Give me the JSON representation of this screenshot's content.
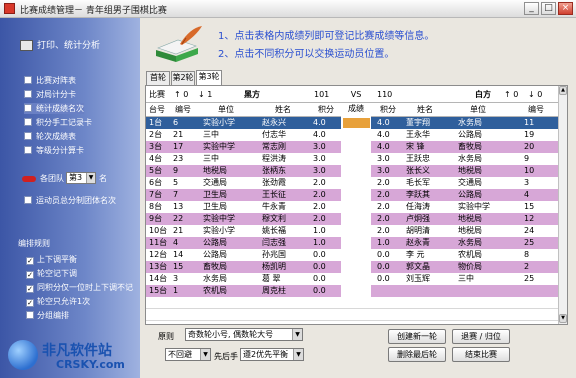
{
  "window": {
    "title": "比赛成绩管理－  青年组男子围棋比赛",
    "min": "_",
    "max": "□",
    "close": "×"
  },
  "sidebar": {
    "section_title": "打印、统计分析",
    "items": [
      {
        "label": "比赛对阵表"
      },
      {
        "label": "对局计分卡"
      },
      {
        "label": "统计成绩名次"
      },
      {
        "label": "积分手工记录卡"
      },
      {
        "label": "轮次成绩表"
      },
      {
        "label": "等级分计算卡"
      }
    ],
    "team_label": "各团队",
    "team_value": "第3",
    "team_suffix": "名",
    "unit_ranking": "运动员总分制团体名次",
    "rules_title": "编排规则",
    "rules": [
      {
        "label": "上下调平衡",
        "checked": "✓"
      },
      {
        "label": "轮空记下调",
        "checked": "✓"
      },
      {
        "label": "同积分仅一位时上下调不记",
        "checked": "✓"
      },
      {
        "label": "轮空只允许1次",
        "checked": "✓"
      },
      {
        "label": "分组编排",
        "checked": ""
      }
    ]
  },
  "hints": [
    "1、点击表格内成绩列即可登记比赛成绩等信息。",
    "2、点击不同积分可以交换运动员位置。"
  ],
  "tabs": [
    "首轮",
    "第2轮",
    "第3轮"
  ],
  "table": {
    "black_label": "比赛",
    "black_up": "↑ 0",
    "black_down": "↓ 1",
    "black_side": "黑方",
    "black_count": "101",
    "vs": "VS",
    "result_label": "成绩",
    "white_count": "110",
    "white_side": "白方",
    "white_up": "↑ 0",
    "white_down": "↓ 0",
    "cols_left": [
      "台号",
      "编号",
      "单位",
      "姓名",
      "积分"
    ],
    "cols_right": [
      "积分",
      "姓名",
      "单位",
      "编号"
    ],
    "rows": [
      {
        "board": "1台",
        "bno": "6",
        "bunit": "实验小学",
        "bname": "赵永兴",
        "bscore": "4.0",
        "wscore": "4.0",
        "wname": "董宇翔",
        "wunit": "水务局",
        "wno": "11",
        "style": "sel"
      },
      {
        "board": "2台",
        "bno": "21",
        "bunit": "三中",
        "bname": "付志华",
        "bscore": "4.0",
        "wscore": "4.0",
        "wname": "王永华",
        "wunit": "公路局",
        "wno": "19",
        "style": "white"
      },
      {
        "board": "3台",
        "bno": "17",
        "bunit": "实验中学",
        "bname": "常志刚",
        "bscore": "3.0",
        "wscore": "4.0",
        "wname": "宋 锋",
        "wunit": "畜牧局",
        "wno": "20",
        "style": "pink"
      },
      {
        "board": "4台",
        "bno": "23",
        "bunit": "三中",
        "bname": "程洪涛",
        "bscore": "3.0",
        "wscore": "3.0",
        "wname": "王跃忠",
        "wunit": "水务局",
        "wno": "9",
        "style": "white"
      },
      {
        "board": "5台",
        "bno": "9",
        "bunit": "地税局",
        "bname": "张柄东",
        "bscore": "3.0",
        "wscore": "3.0",
        "wname": "张长义",
        "wunit": "地税局",
        "wno": "10",
        "style": "pink"
      },
      {
        "board": "6台",
        "bno": "5",
        "bunit": "交通局",
        "bname": "张劲霞",
        "bscore": "2.0",
        "wscore": "2.0",
        "wname": "毛长军",
        "wunit": "交通局",
        "wno": "3",
        "style": "white"
      },
      {
        "board": "7台",
        "bno": "7",
        "bunit": "卫生局",
        "bname": "王长征",
        "bscore": "2.0",
        "wscore": "2.0",
        "wname": "李跃其",
        "wunit": "公路局",
        "wno": "4",
        "style": "pink"
      },
      {
        "board": "8台",
        "bno": "13",
        "bunit": "卫生局",
        "bname": "牛永青",
        "bscore": "2.0",
        "wscore": "2.0",
        "wname": "任海涛",
        "wunit": "实验中学",
        "wno": "15",
        "style": "white"
      },
      {
        "board": "9台",
        "bno": "22",
        "bunit": "实验中学",
        "bname": "穆文利",
        "bscore": "2.0",
        "wscore": "2.0",
        "wname": "卢炯强",
        "wunit": "地税局",
        "wno": "12",
        "style": "pink"
      },
      {
        "board": "10台",
        "bno": "21",
        "bunit": "实验小学",
        "bname": "姚长福",
        "bscore": "1.0",
        "wscore": "2.0",
        "wname": "胡明清",
        "wunit": "地税局",
        "wno": "24",
        "style": "white"
      },
      {
        "board": "11台",
        "bno": "4",
        "bunit": "公路局",
        "bname": "闫志强",
        "bscore": "1.0",
        "wscore": "1.0",
        "wname": "赵永青",
        "wunit": "水务局",
        "wno": "25",
        "style": "pink"
      },
      {
        "board": "12台",
        "bno": "14",
        "bunit": "公路局",
        "bname": "孙兆国",
        "bscore": "0.0",
        "wscore": "0.0",
        "wname": "李 元",
        "wunit": "农机局",
        "wno": "8",
        "style": "white"
      },
      {
        "board": "13台",
        "bno": "15",
        "bunit": "畜牧局",
        "bname": "杨凯明",
        "bscore": "0.0",
        "wscore": "0.0",
        "wname": "郭文晶",
        "wunit": "物价局",
        "wno": "2",
        "style": "pink"
      },
      {
        "board": "14台",
        "bno": "3",
        "bunit": "水务局",
        "bname": "葛 翠",
        "bscore": "0.0",
        "wscore": "0.0",
        "wname": "刘玉辉",
        "wunit": "三中",
        "wno": "25",
        "style": "white"
      },
      {
        "board": "15台",
        "bno": "1",
        "bunit": "农机局",
        "bname": "周克柱",
        "bscore": "0.0",
        "wscore": "",
        "wname": "",
        "wunit": "",
        "wno": "",
        "style": "pink"
      }
    ]
  },
  "controls": {
    "principle_label": "原则",
    "principle_value": "奇数轮小号, 偶数轮大号",
    "opt1_value": "不回避",
    "opt2_label": "先后手",
    "opt2_value": "遵2优先平衡",
    "btn_new_round": "创建新一轮",
    "btn_undo": "退赛 / 归位",
    "btn_delete_last": "删除最后轮",
    "btn_end": "结束比赛"
  },
  "watermark": {
    "line1": "非凡软件站",
    "line2": "CRSKY.com"
  }
}
